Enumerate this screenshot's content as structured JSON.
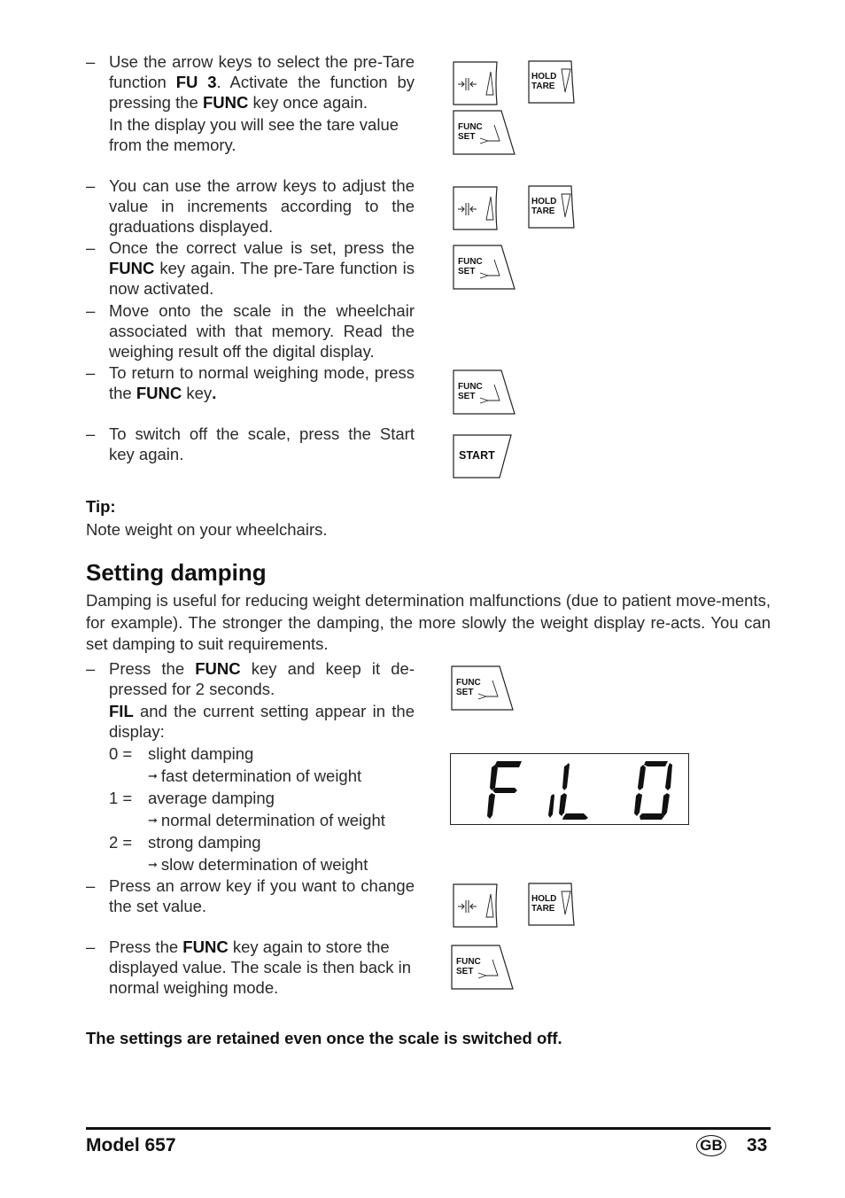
{
  "section1": {
    "steps": [
      {
        "dash": "–",
        "parts": [
          "Use the arrow keys to select the pre-Tare function ",
          "FU 3",
          ". Activate the function by pressing the ",
          "FUNC",
          " key once again."
        ],
        "extra": "In the display you will see the tare value from the memory."
      },
      {
        "dash": "–",
        "text": "You can use the arrow keys to adjust the value in increments according to the graduations displayed."
      },
      {
        "dash": "–",
        "parts": [
          "Once the correct value is set, press the ",
          "FUNC",
          " key again. The pre-Tare function is now activated."
        ]
      },
      {
        "dash": "–",
        "text": "Move onto the scale in the wheelchair associated with that memory. Read the weighing result off the digital display."
      },
      {
        "dash": "–",
        "parts": [
          "To return to normal weighing mode, press the ",
          "FUNC",
          " key",
          "."
        ]
      },
      {
        "dash": "–",
        "text": "To switch off the scale, press the Start key again."
      }
    ]
  },
  "tip": {
    "label": "Tip:",
    "text": "Note weight on your wheelchairs."
  },
  "section2": {
    "title": "Setting damping",
    "intro": "Damping is useful for reducing weight determination malfunctions (due to patient move-ments, for example). The stronger the damping, the more slowly the weight display re-acts. You can set damping to suit requirements.",
    "steps": [
      {
        "dash": "–",
        "parts": [
          "Press the ",
          "FUNC",
          " key and keep it de-pressed for 2 seconds."
        ],
        "extra_parts": [
          "FIL",
          " and the current setting appear in the display:"
        ]
      },
      {
        "dash": "–",
        "text": "Press an arrow key if you want to change the set value."
      },
      {
        "dash": "–",
        "parts": [
          "Press the ",
          "FUNC",
          " key again to store the displayed value. The scale is then back in normal weighing mode."
        ]
      }
    ],
    "settings": [
      {
        "num": "0 =",
        "label": "slight damping",
        "result": "fast determination of weight"
      },
      {
        "num": "1 =",
        "label": "average damping",
        "result": "normal determination of weight"
      },
      {
        "num": "2 =",
        "label": "strong damping",
        "result": "slow determination of weight"
      }
    ],
    "arrow": "➞",
    "note": "The settings are retained even once the scale is switched off."
  },
  "keys": {
    "hold_tare": [
      "HOLD",
      "TARE"
    ],
    "func_set": [
      "FUNC",
      "SET"
    ],
    "start": "START"
  },
  "display": {
    "chars": [
      "F",
      "i",
      "L",
      "0"
    ]
  },
  "footer": {
    "model": "Model 657",
    "lang_badge": "GB",
    "page": "33"
  }
}
